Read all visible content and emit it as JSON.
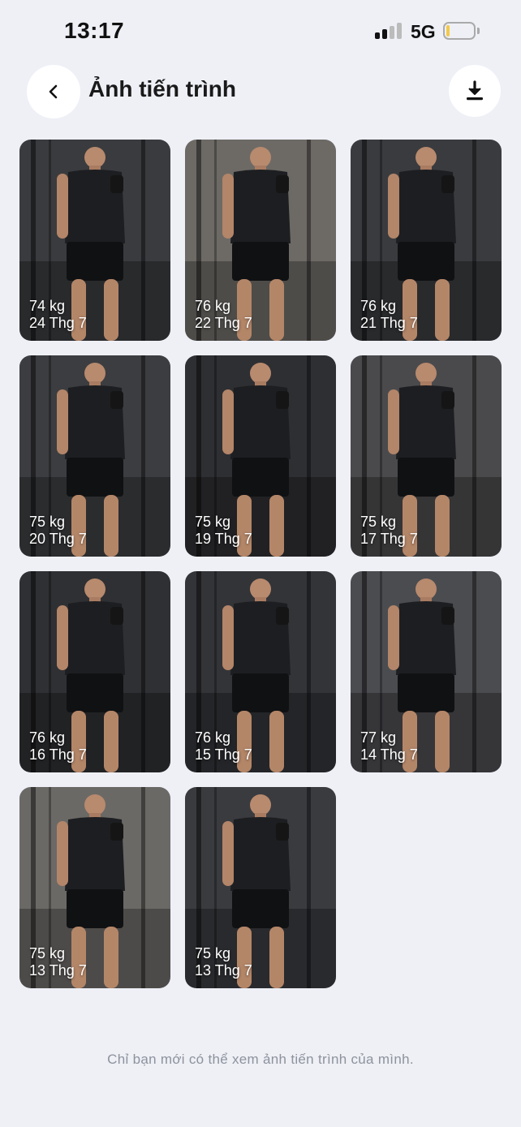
{
  "status_bar": {
    "time": "13:17",
    "network": "5G",
    "signal_bars_active": 2,
    "signal_bars_total": 4,
    "battery_level": 0.12,
    "battery_color": "#f2c94c"
  },
  "header": {
    "title": "Ảnh tiến trình",
    "back_icon": "chevron-left-icon",
    "download_icon": "download-icon"
  },
  "photos": [
    {
      "weight": "74 kg",
      "date": "24 Thg 7",
      "tone": "#3a3b3e"
    },
    {
      "weight": "76 kg",
      "date": "22 Thg 7",
      "tone": "#6d6a66"
    },
    {
      "weight": "76 kg",
      "date": "21 Thg 7",
      "tone": "#3a3b3e"
    },
    {
      "weight": "75 kg",
      "date": "20 Thg 7",
      "tone": "#3c3d40"
    },
    {
      "weight": "75 kg",
      "date": "19 Thg 7",
      "tone": "#2e2f33"
    },
    {
      "weight": "75 kg",
      "date": "17 Thg 7",
      "tone": "#4a4a4c"
    },
    {
      "weight": "76 kg",
      "date": "16 Thg 7",
      "tone": "#2f3033"
    },
    {
      "weight": "76 kg",
      "date": "15 Thg 7",
      "tone": "#333438"
    },
    {
      "weight": "77 kg",
      "date": "14 Thg 7",
      "tone": "#4b4c4f"
    },
    {
      "weight": "75 kg",
      "date": "13 Thg 7",
      "tone": "#6b6966"
    },
    {
      "weight": "75 kg",
      "date": "13 Thg 7",
      "tone": "#3a3b3f"
    }
  ],
  "footer": {
    "note": "Chỉ bạn mới có thể xem ảnh tiến trình của mình."
  },
  "colors": {
    "background": "#eef0f6",
    "button_bg": "#ffffff"
  }
}
